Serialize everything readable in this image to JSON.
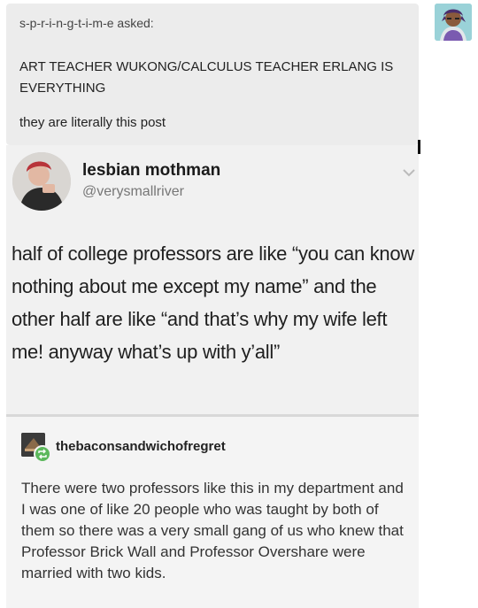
{
  "ask": {
    "asker_line": "s-p-r-i-n-g-t-i-m-e asked:",
    "question": "ART TEACHER WUKONG/CALCULUS TEACHER ERLANG IS EVERYTHING",
    "answer": "they are literally this post"
  },
  "asker_avatar_icon": "avatar-illustration-icon",
  "tweet": {
    "display_name": "lesbian mothman",
    "handle": "@verysmallriver",
    "body": "half of college professors are like “you can know nothing about me except my name” and the other half are like “and that’s why my wife left me! anyway what’s up with y’all”",
    "menu_icon": "chevron-down-icon"
  },
  "reblog": {
    "username": "thebaconsandwichofregret",
    "body": "There were two professors like this in my department and I was one of like 20 people who was taught by both of them so there was a very small gang of us who knew that Professor Brick Wall and Professor Overshare were married with two kids.",
    "badge_icon": "reblog-icon"
  },
  "colors": {
    "ask_background": "#ececec",
    "reblog_badge": "#5cb85c",
    "handle_text": "#777777"
  }
}
